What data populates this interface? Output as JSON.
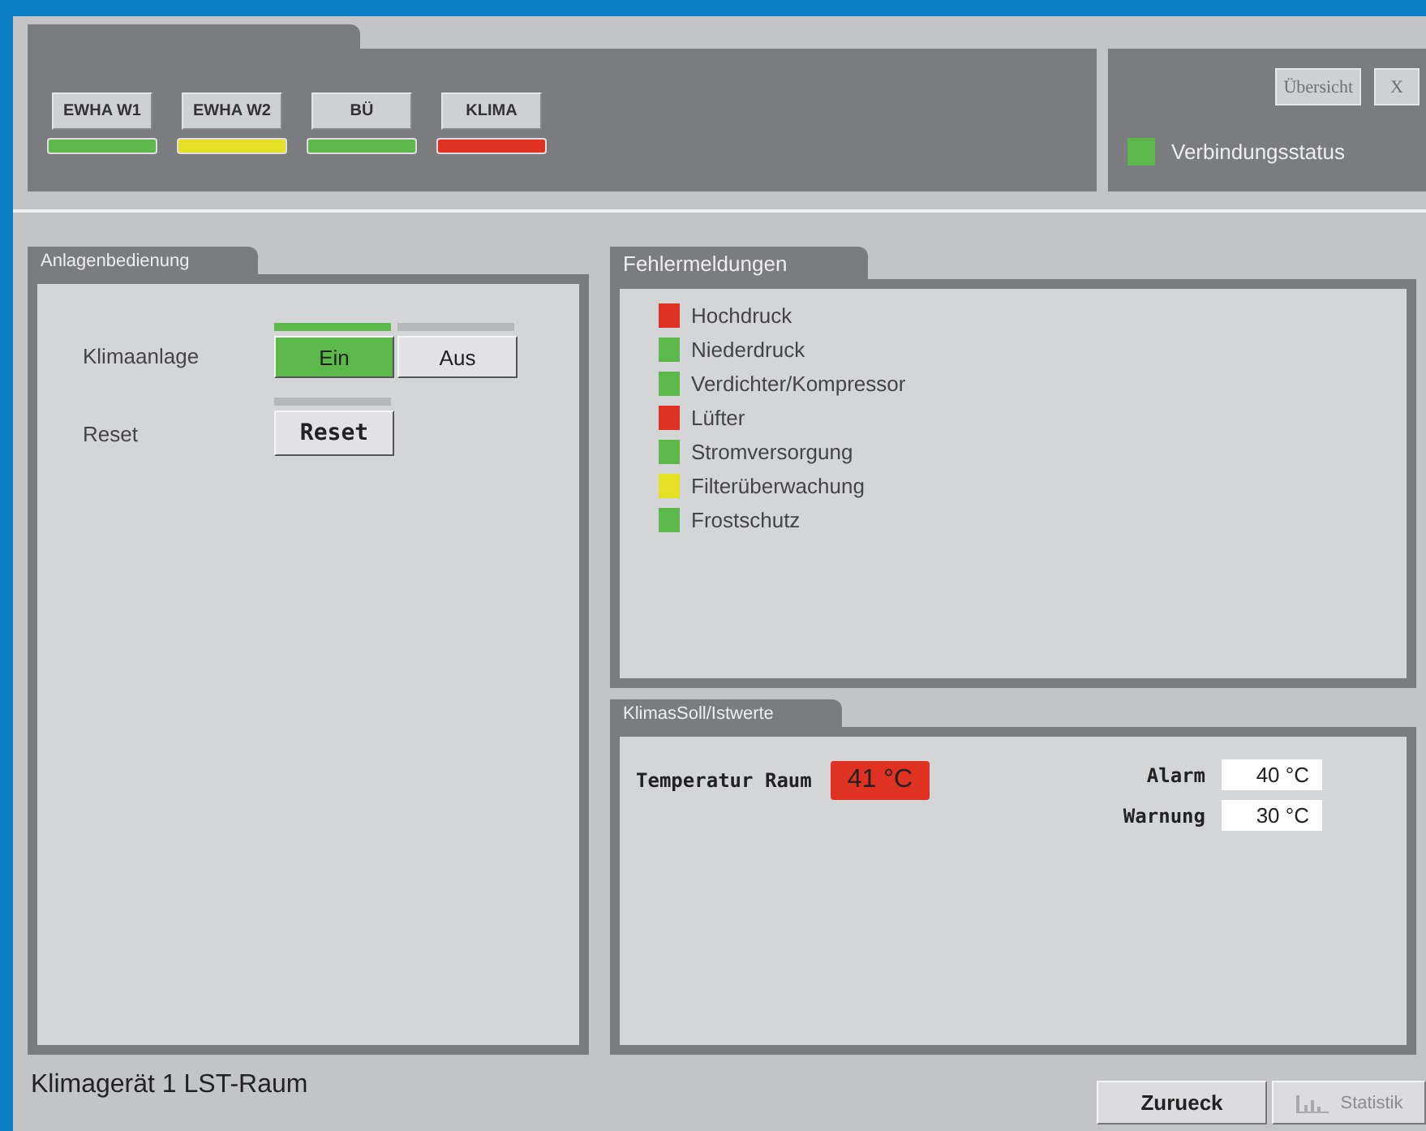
{
  "header": {
    "units": [
      {
        "label": "EWHA W1",
        "color": "#5cb84a"
      },
      {
        "label": "EWHA W2",
        "color": "#e6e025"
      },
      {
        "label": "BÜ",
        "color": "#5cb84a"
      },
      {
        "label": "KLIMA",
        "color": "#e03222"
      }
    ],
    "overview_button": {
      "label": "Übersicht",
      "disabled": true
    },
    "close_button": {
      "label": "X",
      "disabled": true
    },
    "connection": {
      "label": "Verbindungsstatus",
      "color": "#5cb84a"
    }
  },
  "controls": {
    "title": "Anlagenbedienung",
    "rows": [
      {
        "kind": "toggle",
        "label": "Klimaanlage",
        "options": [
          {
            "label": "Ein",
            "selected": true
          },
          {
            "label": "Aus",
            "selected": false
          }
        ]
      },
      {
        "kind": "button",
        "label": "Reset",
        "button": "Reset"
      }
    ]
  },
  "faults": {
    "title": "Fehlermeldungen",
    "items": [
      {
        "label": "Hochdruck",
        "color": "#e03222"
      },
      {
        "label": "Niederdruck",
        "color": "#5cb84a"
      },
      {
        "label": "Verdichter/Kompressor",
        "color": "#5cb84a"
      },
      {
        "label": "Lüfter",
        "color": "#e03222"
      },
      {
        "label": "Stromversorgung",
        "color": "#5cb84a"
      },
      {
        "label": "Filterüberwachung",
        "color": "#e6e025"
      },
      {
        "label": "Frostschutz",
        "color": "#5cb84a"
      }
    ]
  },
  "values": {
    "title": "KlimasSoll/Istwerte",
    "temperature": {
      "label": "Temperatur Raum",
      "value": "41 °C",
      "alarm": true
    },
    "limits": [
      {
        "label": "Alarm",
        "value": "40 °C"
      },
      {
        "label": "Warnung",
        "value": "30 °C"
      }
    ]
  },
  "footer": {
    "title": "Klimagerät 1 LST-Raum",
    "back_button": {
      "label": "Zurueck",
      "disabled": false
    },
    "stats_button": {
      "label": "Statistik",
      "disabled": true
    }
  }
}
